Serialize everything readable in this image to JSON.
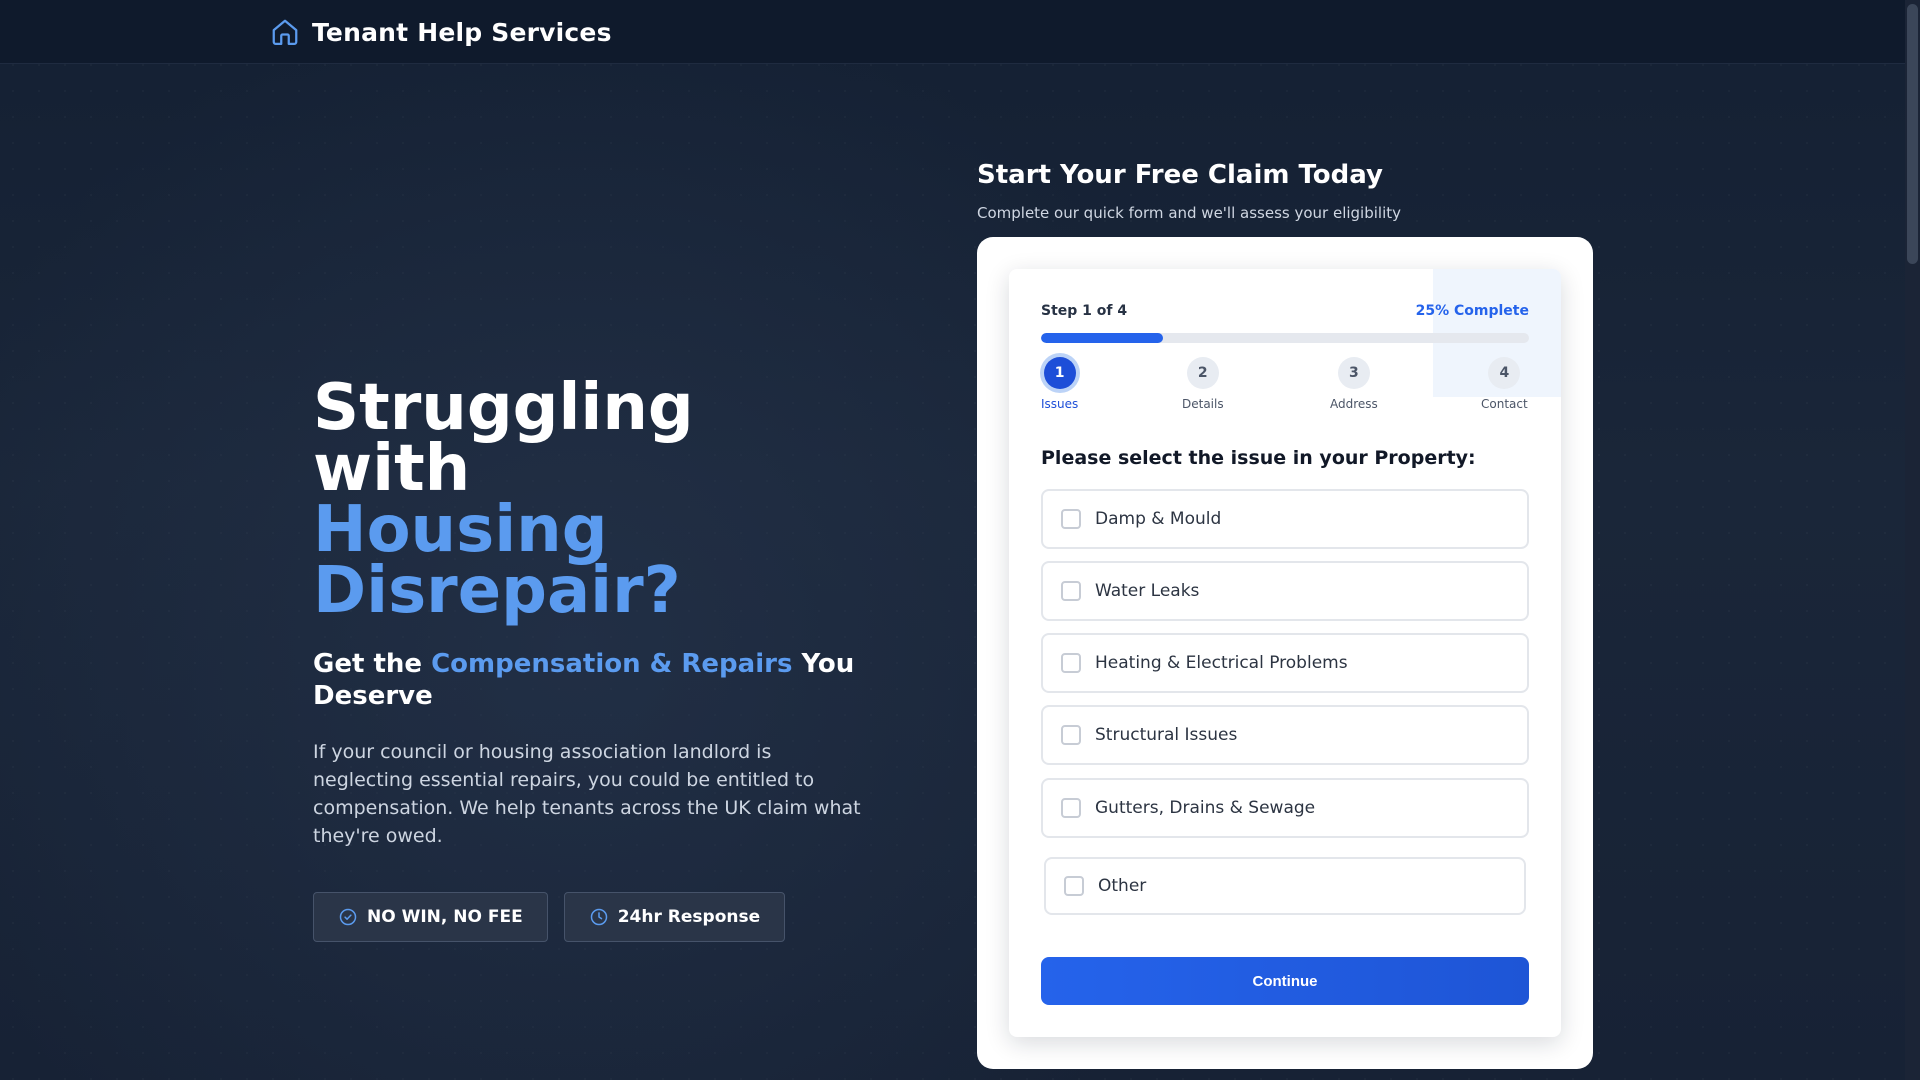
{
  "header": {
    "brand": "Tenant Help Services",
    "icon": "home-icon"
  },
  "hero": {
    "title_line1": "Struggling with",
    "title_accent_line1": "Housing",
    "title_accent_line2": "Disrepair?",
    "subtitle_pre": "Get the ",
    "subtitle_accent": "Compensation & Repairs",
    "subtitle_post": " You Deserve",
    "description": "If your council or housing association landlord is neglecting essential repairs, you could be entitled to compensation. We help tenants across the UK claim what they're owed.",
    "badges": [
      {
        "label": "NO WIN, NO FEE",
        "icon": "check-circle-icon"
      },
      {
        "label": "24hr Response",
        "icon": "clock-icon"
      }
    ]
  },
  "form": {
    "title": "Start Your Free Claim Today",
    "subtitle": "Complete our quick form and we'll assess your eligibility",
    "step_label": "Step 1 of 4",
    "progress_label": "25% Complete",
    "progress_fraction": 0.25,
    "steps": [
      {
        "number": "1",
        "name": "Issues",
        "active": true
      },
      {
        "number": "2",
        "name": "Details",
        "active": false
      },
      {
        "number": "3",
        "name": "Address",
        "active": false
      },
      {
        "number": "4",
        "name": "Contact",
        "active": false
      }
    ],
    "question": "Please select the issue in your Property:",
    "options": [
      {
        "label": "Damp & Mould",
        "checked": false
      },
      {
        "label": "Water Leaks",
        "checked": false
      },
      {
        "label": "Heating & Electrical Problems",
        "checked": false
      },
      {
        "label": "Structural Issues",
        "checked": false
      },
      {
        "label": "Gutters, Drains & Sewage",
        "checked": false
      },
      {
        "label": "Other",
        "checked": false
      }
    ],
    "continue_label": "Continue"
  },
  "colors": {
    "accent": "#5b9bef",
    "primary": "#2563eb",
    "background": "#162032"
  }
}
